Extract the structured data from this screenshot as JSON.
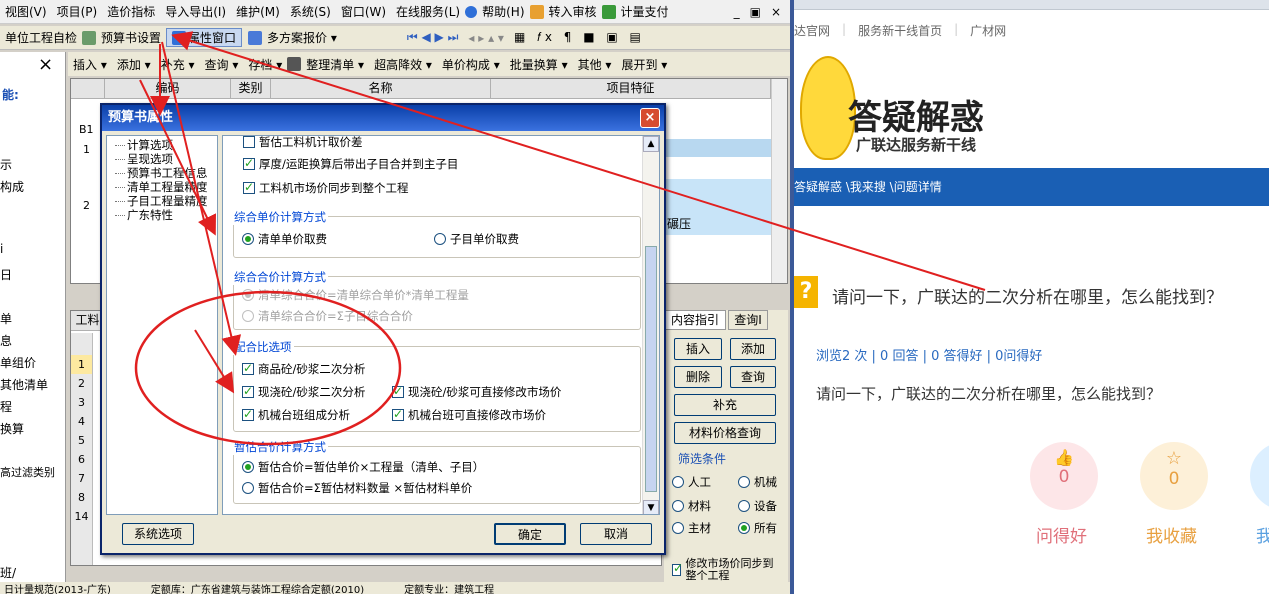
{
  "menu": [
    "视图(V)",
    "项目(P)",
    "造价指标",
    "导入导出(I)",
    "维护(M)",
    "系统(S)",
    "窗口(W)",
    "在线服务(L)",
    "帮助(H)",
    "转入审核",
    "计量支付"
  ],
  "window_controls": [
    "_",
    "▣",
    "×"
  ],
  "toolbar1": {
    "check": "单位工程自检",
    "settings": "预算书设置",
    "props": "属性窗口",
    "multi": "多方案报价 ▾"
  },
  "toolbar2": [
    "插入 ▾",
    "添加 ▾",
    "补充 ▾",
    "查询 ▾",
    "存档 ▾",
    "整理清单 ▾",
    "超高降效 ▾",
    "单价构成 ▾",
    "批量换算 ▾",
    "其他 ▾",
    "展开到 ▾"
  ],
  "left_panel": {
    "close": "×",
    "label": "能:",
    "items": [
      "示",
      "构成",
      "i",
      "日",
      "单",
      "息",
      "单组价",
      "其他清单",
      "程",
      "换算",
      "高过滤类别"
    ],
    "tab": "班/"
  },
  "grid": {
    "headers": [
      "编码",
      "类别",
      "名称",
      "项目特征"
    ],
    "rows": [
      "B1",
      "1",
      "2"
    ],
    "cell_text": "碾压"
  },
  "lower": {
    "tab": "工料",
    "rows": [
      "1",
      "2",
      "3",
      "4",
      "5",
      "6",
      "7",
      "8",
      "14"
    ],
    "right_tabs": [
      "内容指引",
      "查询I"
    ],
    "buttons": [
      "插入",
      "添加",
      "删除",
      "查询",
      "补充",
      "材料价格查询"
    ],
    "filter_title": "筛选条件",
    "filters": [
      {
        "label": "人工",
        "on": false
      },
      {
        "label": "机械",
        "on": false
      },
      {
        "label": "材料",
        "on": false
      },
      {
        "label": "设备",
        "on": false
      },
      {
        "label": "主材",
        "on": false
      },
      {
        "label": "所有",
        "on": true
      }
    ],
    "sync": "修改市场价同步到整个工程"
  },
  "status": [
    "日计量规范(2013-广东)",
    "定额库：广东省建筑与装饰工程综合定额(2010)",
    "定额专业：建筑工程"
  ],
  "dialog": {
    "title": "预算书属性",
    "close": "×",
    "tree": [
      "计算选项",
      "呈现选项",
      "预算书工程信息",
      "清单工程量精度",
      "子目工程量精度",
      "广东特性"
    ],
    "top_checks": [
      {
        "label": "暂估工料机计取价差",
        "on": false
      },
      {
        "label": "厚度/运距换算后带出子目合并到主子目",
        "on": true
      },
      {
        "label": "工料机市场价同步到整个工程",
        "on": true
      }
    ],
    "group1": {
      "title": "综合单价计算方式",
      "options": [
        {
          "label": "清单单价取费",
          "on": true
        },
        {
          "label": "子目单价取费",
          "on": false
        }
      ]
    },
    "group2": {
      "title": "综合合价计算方式",
      "options": [
        {
          "label": "清单综合合价=清单综合单价*清单工程量",
          "on": true
        },
        {
          "label": "清单综合合价=Σ子目综合合价",
          "on": false
        }
      ]
    },
    "group3": {
      "title": "配合比选项",
      "options": [
        {
          "label": "商品砼/砂浆二次分析",
          "on": true
        },
        {
          "label": "现浇砼/砂浆二次分析",
          "on": true
        },
        {
          "label": "现浇砼/砂浆可直接修改市场价",
          "on": true
        },
        {
          "label": "机械台班组成分析",
          "on": true
        },
        {
          "label": "机械台班可直接修改市场价",
          "on": true
        }
      ]
    },
    "group4": {
      "title": "暂估合价计算方式",
      "options": [
        {
          "label": "暂估合价=暂估单价×工程量（清单、子目）",
          "on": true
        },
        {
          "label": "暂估合价=Σ暂估材料数量 ×暂估材料单价",
          "on": false
        }
      ]
    },
    "system_btn": "系统选项",
    "ok_btn": "确定",
    "cancel_btn": "取消"
  },
  "web": {
    "nav": [
      "达官网",
      "服务新干线首页",
      "广材网"
    ],
    "logo_title": "答疑解惑",
    "logo_sub": "广联达服务新干线",
    "breadcrumb": "答疑解惑 \\我来搜 \\问题详情",
    "question": "请问一下，广联达的二次分析在哪里，怎么能找到？",
    "stats": "浏览2 次 | 0 回答 | 0 答得好 | 0问得好",
    "body": "请问一下，广联达的二次分析在哪里，怎么能找到？",
    "actions": [
      {
        "count": "0",
        "label": "问得好",
        "icon": "thumb-up-icon"
      },
      {
        "count": "0",
        "label": "我收藏",
        "icon": "star-icon"
      },
      {
        "label": "我"
      }
    ]
  },
  "colors": {
    "annotation": "#e02020",
    "accent_blue": "#1a5fb4"
  }
}
